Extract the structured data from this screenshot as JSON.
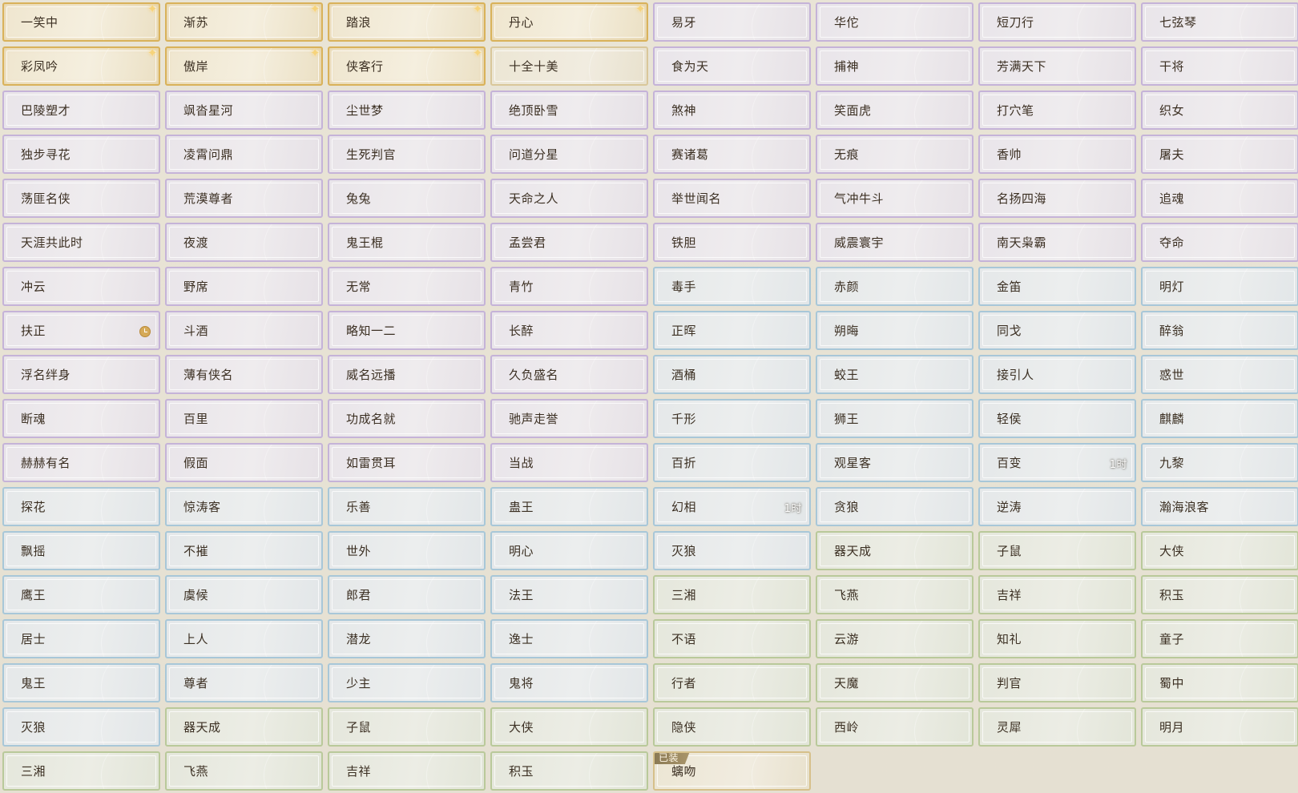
{
  "cards": [
    {
      "label": "一笑中",
      "tier": "gold",
      "spark": true
    },
    {
      "label": "渐苏",
      "tier": "gold",
      "spark": true
    },
    {
      "label": "踏浪",
      "tier": "gold",
      "spark": true
    },
    {
      "label": "丹心",
      "tier": "gold",
      "spark": true
    },
    {
      "label": "易牙",
      "tier": "purple"
    },
    {
      "label": "华佗",
      "tier": "purple"
    },
    {
      "label": "短刀行",
      "tier": "purple"
    },
    {
      "label": "七弦琴",
      "tier": "purple"
    },
    {
      "label": "彩凤吟",
      "tier": "gold",
      "spark": true
    },
    {
      "label": "傲岸",
      "tier": "gold",
      "spark": true
    },
    {
      "label": "侠客行",
      "tier": "gold",
      "spark": true
    },
    {
      "label": "十全十美",
      "tier": "goldpale"
    },
    {
      "label": "食为天",
      "tier": "purple"
    },
    {
      "label": "捕神",
      "tier": "purple"
    },
    {
      "label": "芳满天下",
      "tier": "purple"
    },
    {
      "label": "干将",
      "tier": "purple"
    },
    {
      "label": "巴陵塑才",
      "tier": "purple"
    },
    {
      "label": "飒沓星河",
      "tier": "purple"
    },
    {
      "label": "尘世梦",
      "tier": "purple"
    },
    {
      "label": "绝顶卧雪",
      "tier": "purple"
    },
    {
      "label": "煞神",
      "tier": "purple"
    },
    {
      "label": "笑面虎",
      "tier": "purple"
    },
    {
      "label": "打穴笔",
      "tier": "purple"
    },
    {
      "label": "织女",
      "tier": "purple"
    },
    {
      "label": "独步寻花",
      "tier": "purple"
    },
    {
      "label": "凌霄问鼎",
      "tier": "purple"
    },
    {
      "label": "生死判官",
      "tier": "purple"
    },
    {
      "label": "问道分星",
      "tier": "purple"
    },
    {
      "label": "赛诸葛",
      "tier": "purple"
    },
    {
      "label": "无痕",
      "tier": "purple"
    },
    {
      "label": "香帅",
      "tier": "purple"
    },
    {
      "label": "屠夫",
      "tier": "purple"
    },
    {
      "label": "荡匪名侠",
      "tier": "purple"
    },
    {
      "label": "荒漠尊者",
      "tier": "purple"
    },
    {
      "label": "兔兔",
      "tier": "purple"
    },
    {
      "label": "天命之人",
      "tier": "purple"
    },
    {
      "label": "举世闻名",
      "tier": "purple"
    },
    {
      "label": "气冲牛斗",
      "tier": "purple"
    },
    {
      "label": "名扬四海",
      "tier": "purple"
    },
    {
      "label": "追魂",
      "tier": "purple"
    },
    {
      "label": "天涯共此时",
      "tier": "purple"
    },
    {
      "label": "夜渡",
      "tier": "purple"
    },
    {
      "label": "鬼王棍",
      "tier": "purple"
    },
    {
      "label": "孟尝君",
      "tier": "purple"
    },
    {
      "label": "铁胆",
      "tier": "purple"
    },
    {
      "label": "威震寰宇",
      "tier": "purple"
    },
    {
      "label": "南天枭霸",
      "tier": "purple"
    },
    {
      "label": "夺命",
      "tier": "purple"
    },
    {
      "label": "冲云",
      "tier": "purple"
    },
    {
      "label": "野席",
      "tier": "purple"
    },
    {
      "label": "无常",
      "tier": "purple"
    },
    {
      "label": "青竹",
      "tier": "purple"
    },
    {
      "label": "毒手",
      "tier": "blue"
    },
    {
      "label": "赤颜",
      "tier": "blue"
    },
    {
      "label": "金笛",
      "tier": "blue"
    },
    {
      "label": "明灯",
      "tier": "blue"
    },
    {
      "label": "扶正",
      "tier": "purple",
      "clock": true
    },
    {
      "label": "斗酒",
      "tier": "purple"
    },
    {
      "label": "略知一二",
      "tier": "purple"
    },
    {
      "label": "长醉",
      "tier": "purple"
    },
    {
      "label": "正晖",
      "tier": "blue"
    },
    {
      "label": "朔晦",
      "tier": "blue"
    },
    {
      "label": "同戈",
      "tier": "blue"
    },
    {
      "label": "醉翁",
      "tier": "blue"
    },
    {
      "label": "浮名绊身",
      "tier": "purple"
    },
    {
      "label": "薄有侠名",
      "tier": "purple"
    },
    {
      "label": "威名远播",
      "tier": "purple"
    },
    {
      "label": "久负盛名",
      "tier": "purple"
    },
    {
      "label": "酒桶",
      "tier": "blue"
    },
    {
      "label": "蛟王",
      "tier": "blue"
    },
    {
      "label": "接引人",
      "tier": "blue"
    },
    {
      "label": "惑世",
      "tier": "blue"
    },
    {
      "label": "断魂",
      "tier": "purple"
    },
    {
      "label": "百里",
      "tier": "purple"
    },
    {
      "label": "功成名就",
      "tier": "purple"
    },
    {
      "label": "驰声走誉",
      "tier": "purple"
    },
    {
      "label": "千形",
      "tier": "blue"
    },
    {
      "label": "狮王",
      "tier": "blue"
    },
    {
      "label": "轻侯",
      "tier": "blue"
    },
    {
      "label": "麒麟",
      "tier": "blue"
    },
    {
      "label": "赫赫有名",
      "tier": "purple"
    },
    {
      "label": "假面",
      "tier": "purple"
    },
    {
      "label": "如雷贯耳",
      "tier": "purple"
    },
    {
      "label": "当战",
      "tier": "purple"
    },
    {
      "label": "百折",
      "tier": "blue"
    },
    {
      "label": "观星客",
      "tier": "blue"
    },
    {
      "label": "百变",
      "tier": "blue",
      "timer": "1时"
    },
    {
      "label": "九黎",
      "tier": "blue"
    },
    {
      "label": "探花",
      "tier": "blue"
    },
    {
      "label": "惊涛客",
      "tier": "blue"
    },
    {
      "label": "乐善",
      "tier": "blue"
    },
    {
      "label": "蛊王",
      "tier": "blue"
    },
    {
      "label": "幻相",
      "tier": "blue",
      "timer": "1时"
    },
    {
      "label": "贪狼",
      "tier": "blue"
    },
    {
      "label": "逆涛",
      "tier": "blue"
    },
    {
      "label": "瀚海浪客",
      "tier": "blue"
    },
    {
      "label": "飘摇",
      "tier": "blue"
    },
    {
      "label": "不摧",
      "tier": "blue"
    },
    {
      "label": "世外",
      "tier": "blue"
    },
    {
      "label": "明心",
      "tier": "blue"
    },
    {
      "label": "灭狼",
      "tier": "blue"
    },
    {
      "label": "器天成",
      "tier": "green"
    },
    {
      "label": "子鼠",
      "tier": "green"
    },
    {
      "label": "大侠",
      "tier": "green"
    },
    {
      "label": "鹰王",
      "tier": "blue"
    },
    {
      "label": "虞候",
      "tier": "blue"
    },
    {
      "label": "郎君",
      "tier": "blue"
    },
    {
      "label": "法王",
      "tier": "blue"
    },
    {
      "label": "三湘",
      "tier": "green"
    },
    {
      "label": "飞燕",
      "tier": "green"
    },
    {
      "label": "吉祥",
      "tier": "green"
    },
    {
      "label": "积玉",
      "tier": "green"
    },
    {
      "label": "居士",
      "tier": "blue"
    },
    {
      "label": "上人",
      "tier": "blue"
    },
    {
      "label": "潜龙",
      "tier": "blue"
    },
    {
      "label": "逸士",
      "tier": "blue"
    },
    {
      "label": "不语",
      "tier": "green"
    },
    {
      "label": "云游",
      "tier": "green"
    },
    {
      "label": "知礼",
      "tier": "green"
    },
    {
      "label": "童子",
      "tier": "green"
    },
    {
      "label": "鬼王",
      "tier": "blue"
    },
    {
      "label": "尊者",
      "tier": "blue"
    },
    {
      "label": "少主",
      "tier": "blue"
    },
    {
      "label": "鬼将",
      "tier": "blue"
    },
    {
      "label": "行者",
      "tier": "green"
    },
    {
      "label": "天魔",
      "tier": "green"
    },
    {
      "label": "判官",
      "tier": "green"
    },
    {
      "label": "蜀中",
      "tier": "green"
    },
    {
      "label": "灭狼",
      "tier": "blue"
    },
    {
      "label": "器天成",
      "tier": "green"
    },
    {
      "label": "子鼠",
      "tier": "green"
    },
    {
      "label": "大侠",
      "tier": "green"
    },
    {
      "label": "隐侠",
      "tier": "green"
    },
    {
      "label": "西岭",
      "tier": "green"
    },
    {
      "label": "灵犀",
      "tier": "green"
    },
    {
      "label": "明月",
      "tier": "green"
    },
    {
      "label": "三湘",
      "tier": "green"
    },
    {
      "label": "飞燕",
      "tier": "green"
    },
    {
      "label": "吉祥",
      "tier": "green"
    },
    {
      "label": "积玉",
      "tier": "green"
    },
    {
      "label": "螭吻",
      "tier": "equipped",
      "equipped": "已装"
    }
  ],
  "icons": {
    "spark": "sparkle-icon",
    "clock": "clock-icon"
  },
  "colors": {
    "gold_border": "#d9b25a",
    "purple_border": "#c5b3d8",
    "blue_border": "#a8c7d8",
    "green_border": "#b9c99a",
    "text": "#3b2f22"
  }
}
